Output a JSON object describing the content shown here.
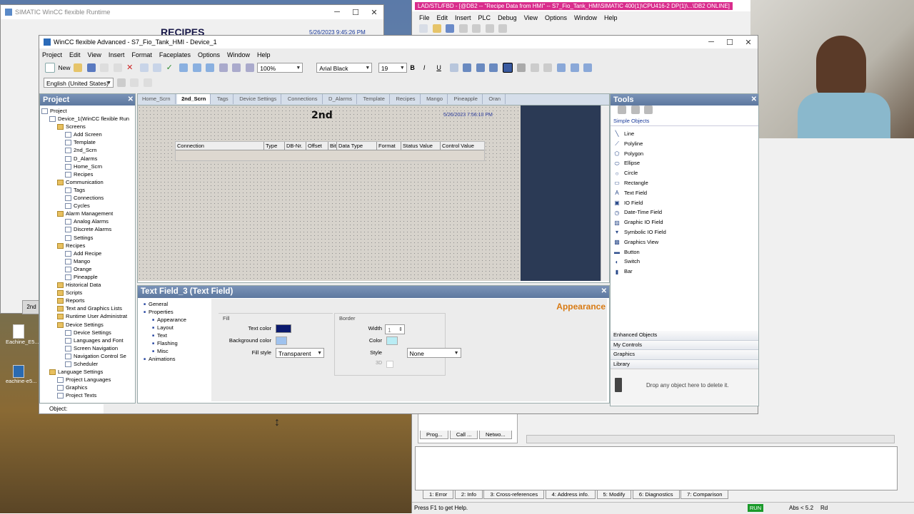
{
  "runtime_window": {
    "title": "SIMATIC WinCC flexible Runtime",
    "heading": "RECIPES",
    "timestamp": "5/26/2023 9:45:26 PM",
    "side_label": "2nd"
  },
  "desktop_icons": [
    {
      "label": "Eachine_E5..."
    },
    {
      "label": "eachine-e5..."
    }
  ],
  "lad_window": {
    "title": "LAD/STL/FBD - [@DB2 -- \"Recipe Data from HMI\" -- S7_Fio_Tank_HMI\\SIMATIC 400(1)\\CPU416-2 DP(1)\\...\\DB2  ONLINE]",
    "menu": [
      "File",
      "Edit",
      "Insert",
      "PLC",
      "Debug",
      "View",
      "Options",
      "Window",
      "Help"
    ],
    "bottom_tabs": [
      "1: Error",
      "2: Info",
      "3: Cross-references",
      "4: Address info.",
      "5: Modify",
      "6: Diagnostics",
      "7: Comparison"
    ],
    "left_tabs": [
      "Prog...",
      "Call ...",
      "Netwo..."
    ],
    "status_help": "Press F1 to get Help.",
    "status_run": "RUN",
    "status_abs": "Abs < 5.2",
    "status_rd": "Rd"
  },
  "main_window": {
    "title": "WinCC flexible Advanced - S7_Fio_Tank_HMI - Device_1",
    "menu": [
      "Project",
      "Edit",
      "View",
      "Insert",
      "Format",
      "Faceplates",
      "Options",
      "Window",
      "Help"
    ],
    "new_label": "New",
    "zoom": "100%",
    "font": "Arial Black",
    "font_size": "19",
    "language": "English (United States)",
    "object_status": "Object:"
  },
  "project_panel": {
    "title": "Project",
    "tree": [
      {
        "label": "Project",
        "level": 0
      },
      {
        "label": "Device_1(WinCC flexible Run",
        "level": 1
      },
      {
        "label": "Screens",
        "level": 2,
        "folder": true
      },
      {
        "label": "Add Screen",
        "level": 3
      },
      {
        "label": "Template",
        "level": 3
      },
      {
        "label": "2nd_Scrn",
        "level": 3
      },
      {
        "label": "D_Alarms",
        "level": 3
      },
      {
        "label": "Home_Scrn",
        "level": 3
      },
      {
        "label": "Recipes",
        "level": 3
      },
      {
        "label": "Communication",
        "level": 2,
        "folder": true
      },
      {
        "label": "Tags",
        "level": 3
      },
      {
        "label": "Connections",
        "level": 3
      },
      {
        "label": "Cycles",
        "level": 3
      },
      {
        "label": "Alarm Management",
        "level": 2,
        "folder": true
      },
      {
        "label": "Analog Alarms",
        "level": 3
      },
      {
        "label": "Discrete Alarms",
        "level": 3
      },
      {
        "label": "Settings",
        "level": 3
      },
      {
        "label": "Recipes",
        "level": 2,
        "folder": true
      },
      {
        "label": "Add Recipe",
        "level": 3
      },
      {
        "label": "Mango",
        "level": 3
      },
      {
        "label": "Orange",
        "level": 3
      },
      {
        "label": "Pineapple",
        "level": 3
      },
      {
        "label": "Historical Data",
        "level": 2,
        "folder": true
      },
      {
        "label": "Scripts",
        "level": 2,
        "folder": true
      },
      {
        "label": "Reports",
        "level": 2,
        "folder": true
      },
      {
        "label": "Text and Graphics Lists",
        "level": 2,
        "folder": true
      },
      {
        "label": "Runtime User Administrat",
        "level": 2,
        "folder": true
      },
      {
        "label": "Device Settings",
        "level": 2,
        "folder": true
      },
      {
        "label": "Device Settings",
        "level": 3
      },
      {
        "label": "Languages and Font",
        "level": 3
      },
      {
        "label": "Screen Navigation",
        "level": 3
      },
      {
        "label": "Navigation Control Se",
        "level": 3
      },
      {
        "label": "Scheduler",
        "level": 3
      },
      {
        "label": "Language Settings",
        "level": 1,
        "folder": true
      },
      {
        "label": "Project Languages",
        "level": 2
      },
      {
        "label": "Graphics",
        "level": 2
      },
      {
        "label": "Project Texts",
        "level": 2
      }
    ]
  },
  "editor": {
    "tabs": [
      "Home_Scrn",
      "2nd_Scrn",
      "Tags",
      "Device Settings",
      "Connections",
      "D_Alarms",
      "Template",
      "Recipes",
      "Mango",
      "Pineapple",
      "Oran"
    ],
    "active_tab": "2nd_Scrn",
    "screen_title": "2nd",
    "screen_date": "5/26/2023 7:56:10 PM",
    "table_columns": [
      "Connection",
      "Type",
      "DB-Nr.",
      "Offset",
      "Bit",
      "Data Type",
      "Format",
      "Status Value",
      "Control Value"
    ]
  },
  "tools_panel": {
    "title": "Tools",
    "section": "Simple Objects",
    "items": [
      {
        "label": "Line",
        "icon": "line-icon"
      },
      {
        "label": "Polyline",
        "icon": "polyline-icon"
      },
      {
        "label": "Polygon",
        "icon": "polygon-icon"
      },
      {
        "label": "Ellipse",
        "icon": "ellipse-icon"
      },
      {
        "label": "Circle",
        "icon": "circle-icon"
      },
      {
        "label": "Rectangle",
        "icon": "rectangle-icon"
      },
      {
        "label": "Text Field",
        "icon": "text-field-icon"
      },
      {
        "label": "IO Field",
        "icon": "io-field-icon"
      },
      {
        "label": "Date-Time Field",
        "icon": "date-time-icon"
      },
      {
        "label": "Graphic IO Field",
        "icon": "graphic-io-icon"
      },
      {
        "label": "Symbolic IO Field",
        "icon": "symbolic-io-icon"
      },
      {
        "label": "Graphics View",
        "icon": "graphics-view-icon"
      },
      {
        "label": "Button",
        "icon": "button-icon"
      },
      {
        "label": "Switch",
        "icon": "switch-icon"
      },
      {
        "label": "Bar",
        "icon": "bar-icon"
      }
    ],
    "accordion": [
      "Enhanced Objects",
      "My Controls",
      "Graphics",
      "Library"
    ],
    "delete_hint": "Drop any object here to delete it."
  },
  "properties_panel": {
    "title": "Text Field_3 (Text Field)",
    "tree": [
      {
        "label": "General",
        "level": 0
      },
      {
        "label": "Properties",
        "level": 0
      },
      {
        "label": "Appearance",
        "level": 1
      },
      {
        "label": "Layout",
        "level": 1
      },
      {
        "label": "Text",
        "level": 1
      },
      {
        "label": "Flashing",
        "level": 1
      },
      {
        "label": "Misc",
        "level": 1
      },
      {
        "label": "Animations",
        "level": 0
      }
    ],
    "heading": "Appearance",
    "fill_group": "Fill",
    "text_color_label": "Text color",
    "text_color_value": "#0b1a6e",
    "bg_color_label": "Background color",
    "bg_color_value": "#9fc2ee",
    "fill_style_label": "Fill style",
    "fill_style_value": "Transparent",
    "border_group": "Border",
    "width_label": "Width",
    "width_value": "1",
    "color_label": "Color",
    "color_value": "#b9ecf4",
    "style_label": "Style",
    "style_value": "None",
    "threed_label": "3D"
  }
}
